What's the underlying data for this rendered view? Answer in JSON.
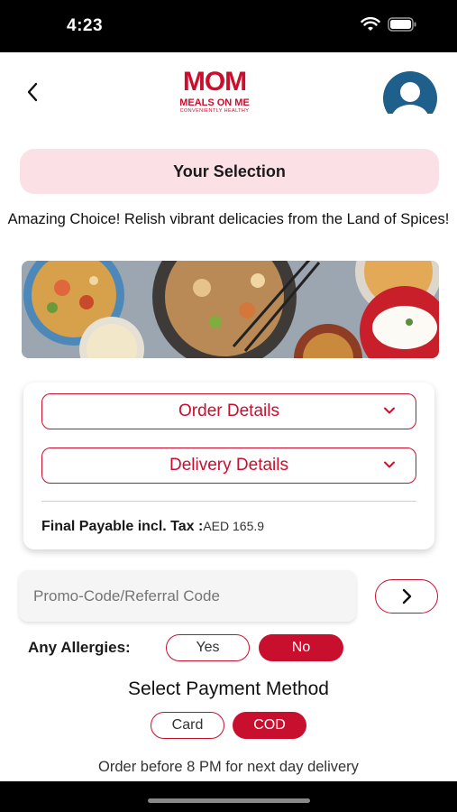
{
  "status_bar": {
    "time": "4:23"
  },
  "header": {
    "logo": {
      "brand": "MOM",
      "name": "MEALS ON ME",
      "tagline": "CONVENIENTLY HEALTHY"
    },
    "icons": {
      "back": "chevron-left-icon",
      "profile": "user-avatar-icon"
    }
  },
  "selection": {
    "title": "Your Selection",
    "description": "Amazing Choice! Relish vibrant delicacies from the Land of Spices!"
  },
  "details_card": {
    "order_details_label": "Order Details",
    "delivery_details_label": "Delivery Details",
    "payable_label": "Final Payable incl. Tax :",
    "payable_amount": "AED 165.9"
  },
  "promo": {
    "placeholder": "Promo-Code/Referral Code"
  },
  "allergies": {
    "label": "Any Allergies:",
    "options": [
      "Yes",
      "No"
    ],
    "selected": "No"
  },
  "payment": {
    "title": "Select Payment Method",
    "options": [
      "Card",
      "COD"
    ],
    "selected": "COD"
  },
  "footer": {
    "note": "Order before 8 PM for next day delivery"
  },
  "colors": {
    "accent": "#c8102e",
    "header_bg": "#fbe1e6",
    "avatar": "#1f5f8b"
  }
}
